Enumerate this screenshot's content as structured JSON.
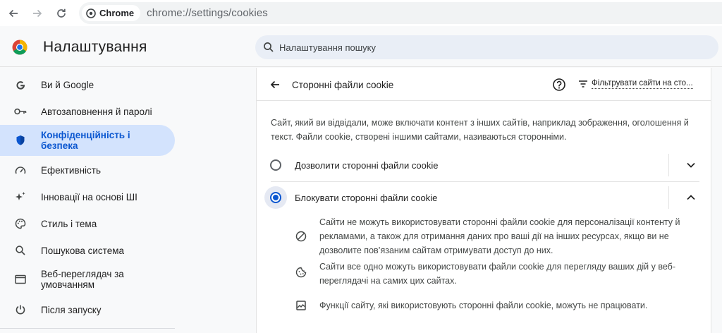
{
  "browser": {
    "chip_label": "Chrome",
    "url": "chrome://settings/cookies"
  },
  "header": {
    "title": "Налаштування",
    "search_placeholder": "Налаштування пошуку"
  },
  "sidebar": {
    "items": [
      {
        "label": "Ви й Google",
        "icon": "google-g-icon"
      },
      {
        "label": "Автозаповнення й паролі",
        "icon": "key-icon"
      },
      {
        "label": "Конфіденційність і безпека",
        "icon": "shield-icon",
        "active": true
      },
      {
        "label": "Ефективність",
        "icon": "speedometer-icon"
      },
      {
        "label": "Інновації на основі ШІ",
        "icon": "sparkle-icon"
      },
      {
        "label": "Стиль і тема",
        "icon": "palette-icon"
      },
      {
        "label": "Пошукова система",
        "icon": "search-icon"
      },
      {
        "label": "Веб-переглядач за умовчанням",
        "icon": "browser-window-icon"
      },
      {
        "label": "Після запуску",
        "icon": "power-icon"
      }
    ]
  },
  "page": {
    "title": "Сторонні файли cookie",
    "filter_label": "Фільтрувати сайти на сто...",
    "description": "Сайт, який ви відвідали, може включати контент з інших сайтів, наприклад зображення, оголошення й текст. Файли cookie, створені іншими сайтами, називаються сторонніми.",
    "options": [
      {
        "label": "Дозволити сторонні файли cookie",
        "selected": false,
        "expanded": false
      },
      {
        "label": "Блокувати сторонні файли cookie",
        "selected": true,
        "expanded": true
      }
    ],
    "details": [
      {
        "icon": "block-icon",
        "text": "Сайти не можуть використовувати сторонні файли cookie для персоналізації контенту й рекламами, а також для отримання даних про ваші дії на інших ресурсах, якщо ви не дозволите пов’язаним сайтам отримувати доступ до них."
      },
      {
        "icon": "cookie-icon",
        "text": "Сайти все одно можуть використовувати файли cookie для перегляду ваших дій у веб­переглядачі на самих цих сайтах."
      },
      {
        "icon": "broken-image-icon",
        "text": "Функції сайту, які використовують сторонні файли cookie, можуть не працювати."
      }
    ]
  },
  "colors": {
    "accent": "#0b57d0",
    "active_bg": "#d3e3fd",
    "search_bg": "#e9eef6"
  }
}
